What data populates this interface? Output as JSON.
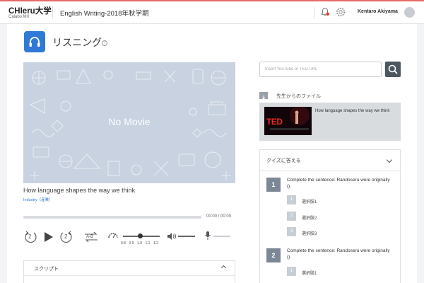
{
  "header": {
    "logo_main": "CHIeru大学",
    "logo_sub": "Calabo MX",
    "course_title": "English Writing-2018年秋学期",
    "user_name": "Kentaro Akiyama",
    "icons": [
      "bell-icon",
      "gear-icon",
      "avatar"
    ]
  },
  "page": {
    "title": "リスニング",
    "help": "?",
    "icon": "headphones-icon"
  },
  "player": {
    "no_movie": "No Movie",
    "video_title": "How language shapes the way we think",
    "tag": "Industry（産業）",
    "time": "00:00 / 00:00",
    "rewind_label": "2",
    "forward_label": "2",
    "ab_label": "A-B",
    "speed_labels": [
      "0.8",
      "0.9",
      "1.0",
      "1.1",
      "1.2"
    ],
    "speed_value": 1.0
  },
  "script_panel": {
    "label": "スクリプト"
  },
  "url_search": {
    "placeholder": "Insert YouTube or TED URL"
  },
  "files": {
    "label": "先生からのファイル",
    "item_title": "How language shapes the way we think",
    "thumb_text": "TED"
  },
  "quiz": {
    "title": "クイズに答える",
    "questions": [
      {
        "number": "1",
        "text": "Complete the sentence: Randoseru were originally ().",
        "options": [
          {
            "number": "1",
            "label": "選択肢1"
          },
          {
            "number": "2",
            "label": "選択肢2"
          },
          {
            "number": "3",
            "label": "選択肢3"
          }
        ]
      },
      {
        "number": "2",
        "text": "Complete the sentence: Randoseru were originally ().",
        "options": [
          {
            "number": "1",
            "label": "選択肢1"
          }
        ]
      }
    ]
  },
  "colors": {
    "accent": "#2f7ad6",
    "topbar_stripe": "#e46a63",
    "video_bg": "#c8d2e0",
    "qnum_bg": "#7b8794"
  }
}
